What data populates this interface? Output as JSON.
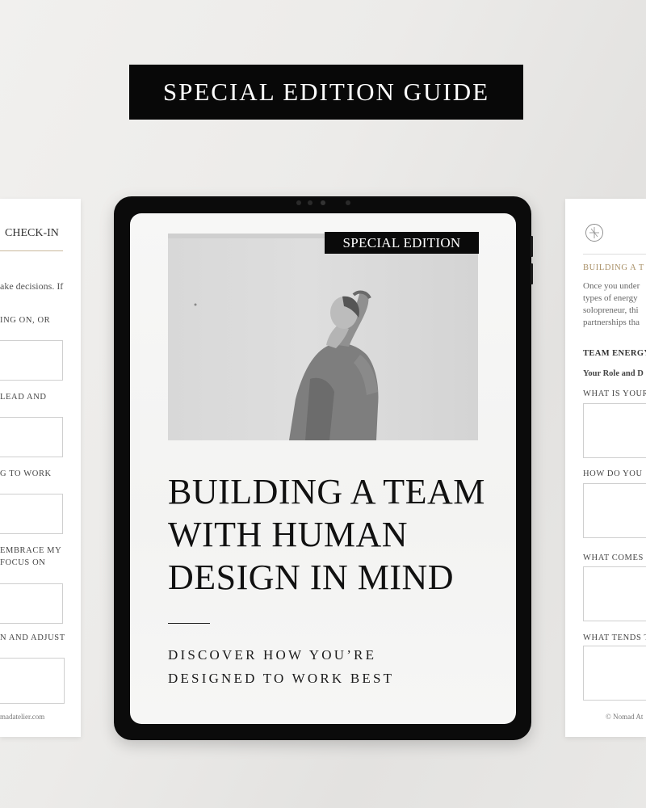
{
  "banner": {
    "title": "SPECIAL EDITION GUIDE"
  },
  "left_sheet": {
    "heading": "CHECK-IN",
    "body": "ake decisions. If",
    "q1": "ING ON, OR",
    "q2": "LEAD AND",
    "q3": "G TO WORK",
    "q4a": "EMBRACE MY",
    "q4b": "FOCUS ON",
    "q5": "N AND ADJUST",
    "footer": "madatelier.com"
  },
  "right_sheet": {
    "section_title": "BUILDING A T",
    "para": [
      "Once you under",
      "types of energy",
      "solopreneur, thi",
      "partnerships tha"
    ],
    "team_energy": "TEAM ENERGY",
    "role": "Your Role and D",
    "q1": "WHAT IS YOUR",
    "q2": "HOW DO YOU",
    "q3": "WHAT COMES",
    "q4": "WHAT TENDS T",
    "footer": "© Nomad At"
  },
  "tablet": {
    "tag": "SPECIAL EDITION",
    "headline": [
      "BUILDING A TEAM",
      "WITH HUMAN",
      "DESIGN IN MIND"
    ],
    "subtitle": [
      "DISCOVER HOW YOU’RE",
      "DESIGNED TO WORK BEST"
    ]
  }
}
